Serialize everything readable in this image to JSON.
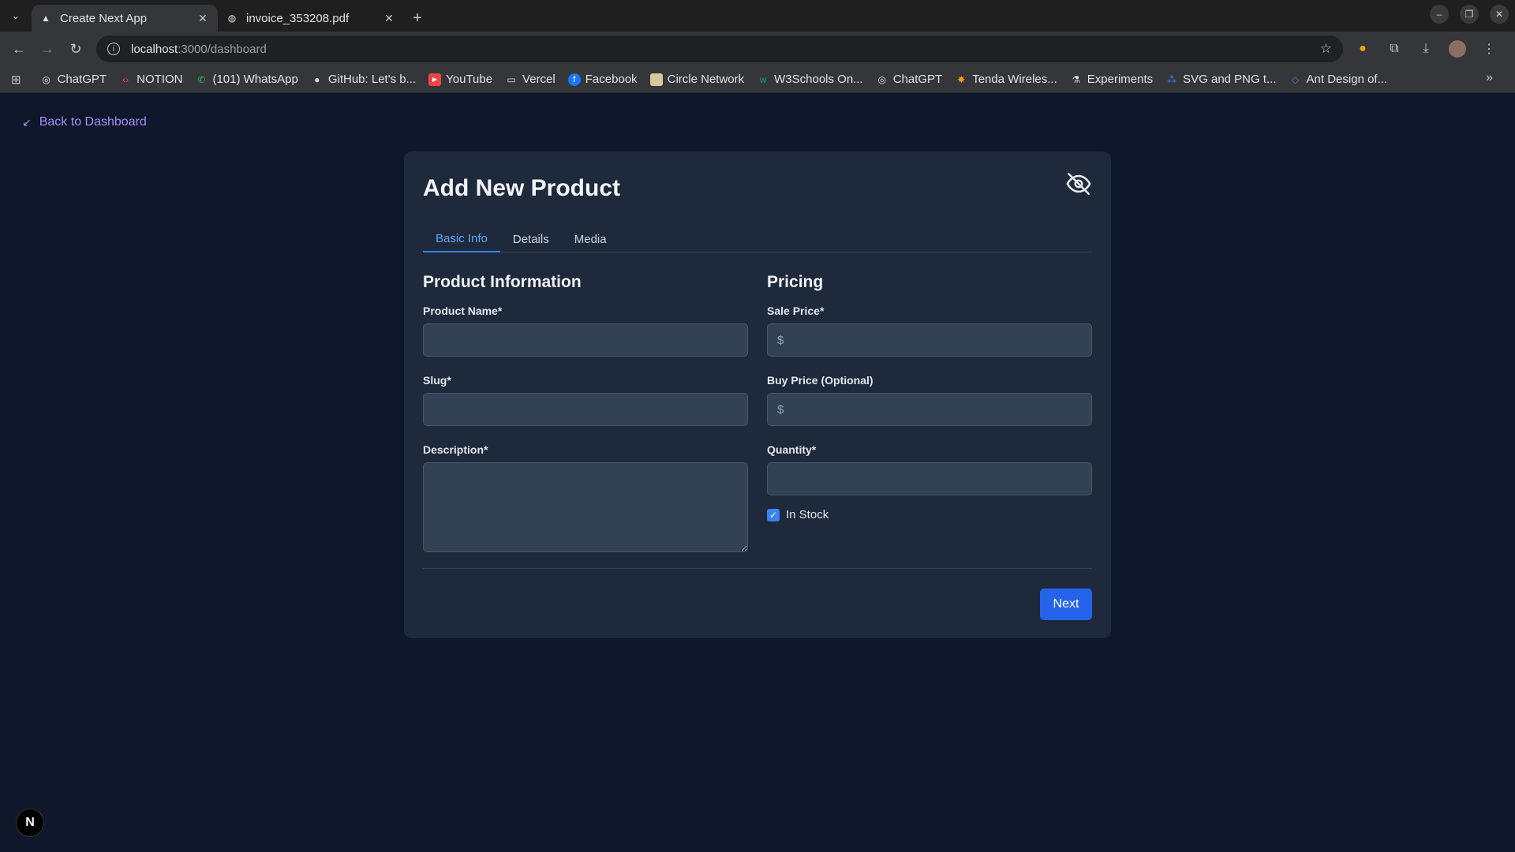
{
  "browser": {
    "tabs": [
      {
        "title": "Create Next App",
        "active": true,
        "icon": "triangle-icon"
      },
      {
        "title": "invoice_353208.pdf",
        "active": false,
        "icon": "globe-icon"
      }
    ],
    "url_host": "localhost",
    "url_path": ":3000/dashboard",
    "bookmarks": [
      "ChatGPT",
      "NOTION",
      "(101) WhatsApp",
      "GitHub: Let's b...",
      "YouTube",
      "Vercel",
      "Facebook",
      "Circle Network",
      "W3Schools On...",
      "ChatGPT",
      "Tenda Wireles...",
      "Experiments",
      "SVG and PNG t...",
      "Ant Design of..."
    ]
  },
  "page": {
    "back_link": "Back to Dashboard",
    "title": "Add New Product",
    "tabs": [
      "Basic Info",
      "Details",
      "Media"
    ],
    "product_info": {
      "heading": "Product Information",
      "name_label": "Product Name*",
      "slug_label": "Slug*",
      "description_label": "Description*"
    },
    "pricing": {
      "heading": "Pricing",
      "sale_label": "Sale Price*",
      "sale_placeholder": "$",
      "buy_label": "Buy Price (Optional)",
      "buy_placeholder": "$",
      "quantity_label": "Quantity*",
      "in_stock_label": "In Stock",
      "in_stock_checked": true
    },
    "next_label": "Next",
    "badge": "N"
  },
  "colors": {
    "background": "#0f172a",
    "card": "#1e293b",
    "accent": "#2563eb",
    "link": "#a78bfa"
  }
}
